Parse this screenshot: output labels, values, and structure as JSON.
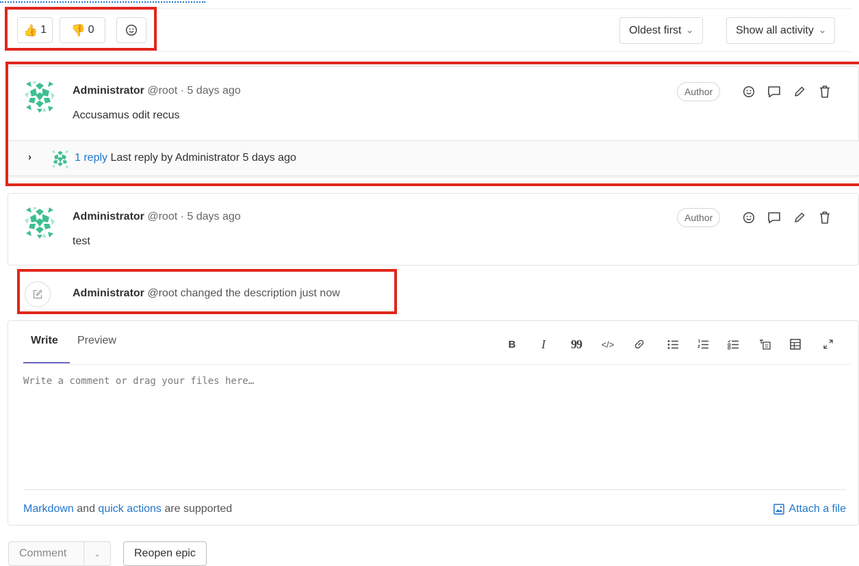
{
  "awards": {
    "thumbs_up": {
      "emoji": "👍",
      "count": "1"
    },
    "thumbs_down": {
      "emoji": "👎",
      "count": "0"
    },
    "add_reaction_icon": "smiley-icon"
  },
  "sort": {
    "order_label": "Oldest first",
    "filter_label": "Show all activity"
  },
  "notes": [
    {
      "author_name": "Administrator",
      "author_meta": "@root · 5 days ago",
      "body": "Accusamus odit recus",
      "badge": "Author",
      "reply": {
        "link": "1 reply",
        "text_prefix": "Last reply by",
        "text_author": "Administrator",
        "text_time": "5 days ago"
      }
    },
    {
      "author_name": "Administrator",
      "author_meta": "@root · 5 days ago",
      "body": "test",
      "badge": "Author"
    }
  ],
  "system_note": {
    "author_name": "Administrator",
    "text": "@root changed the description just now"
  },
  "editor": {
    "tab_write": "Write",
    "tab_preview": "Preview",
    "placeholder": "Write a comment or drag your files here…",
    "footer_markdown": "Markdown",
    "footer_and": "and",
    "footer_quick_actions": "quick actions",
    "footer_supported": "are supported",
    "attach_label": "Attach a file",
    "toolbar": {
      "bold": "B",
      "italic": "I",
      "quote": "99",
      "code": "</>"
    }
  },
  "actions": {
    "comment_label": "Comment",
    "reopen_label": "Reopen epic"
  },
  "colors": {
    "link": "#1f75cb",
    "highlight": "#e0261c",
    "tab_active": "#6666c4"
  }
}
